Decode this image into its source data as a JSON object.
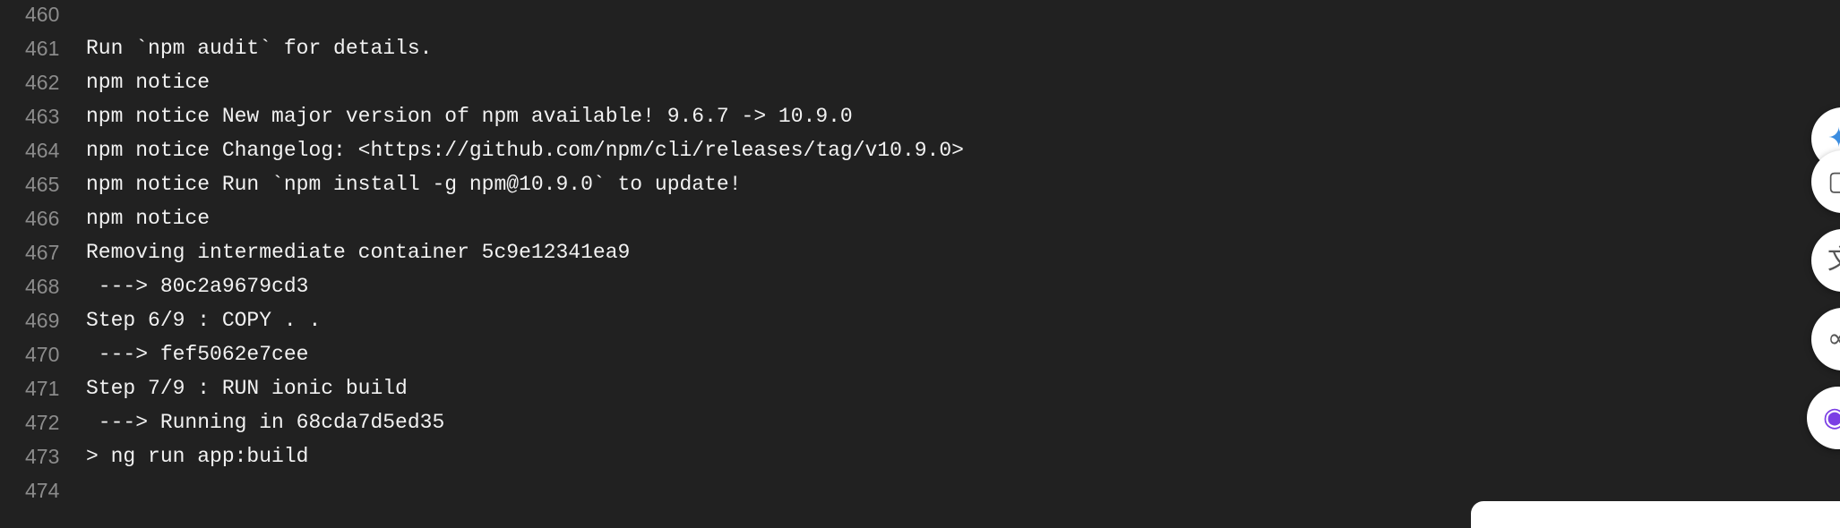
{
  "log": {
    "lines": [
      {
        "no": "460",
        "text": ""
      },
      {
        "no": "461",
        "text": "Run `npm audit` for details."
      },
      {
        "no": "462",
        "text": "npm notice"
      },
      {
        "no": "463",
        "text": "npm notice New major version of npm available! 9.6.7 -> 10.9.0"
      },
      {
        "no": "464",
        "text": "npm notice Changelog: <https://github.com/npm/cli/releases/tag/v10.9.0>"
      },
      {
        "no": "465",
        "text": "npm notice Run `npm install -g npm@10.9.0` to update!"
      },
      {
        "no": "466",
        "text": "npm notice"
      },
      {
        "no": "467",
        "text": "Removing intermediate container 5c9e12341ea9"
      },
      {
        "no": "468",
        "text": " ---> 80c2a9679cd3"
      },
      {
        "no": "469",
        "text": "Step 6/9 : COPY . ."
      },
      {
        "no": "470",
        "text": " ---> fef5062e7cee"
      },
      {
        "no": "471",
        "text": "Step 7/9 : RUN ionic build"
      },
      {
        "no": "472",
        "text": " ---> Running in 68cda7d5ed35"
      },
      {
        "no": "473",
        "text": "> ng run app:build"
      },
      {
        "no": "474",
        "text": ""
      }
    ]
  },
  "floating_toolbar": {
    "buttons": [
      {
        "icon": "ai-sparkle-icon",
        "glyph": "✦"
      },
      {
        "icon": "copy-icon",
        "glyph": "▢"
      },
      {
        "icon": "translate-icon",
        "glyph": "文"
      },
      {
        "icon": "link-icon",
        "glyph": "∞"
      },
      {
        "icon": "assistant-icon",
        "glyph": "◉"
      }
    ]
  },
  "colors": {
    "background": "#212121",
    "text": "#f2f2f2",
    "line_number": "#8c8c8c",
    "assistant_accent": "#7b3fe4",
    "sparkle_accent": "#3b8de0"
  }
}
